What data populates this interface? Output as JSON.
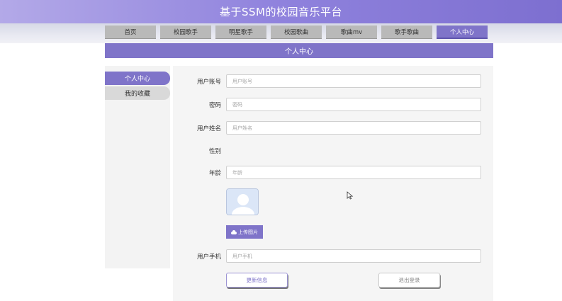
{
  "header": {
    "title": "基于SSM的校园音乐平台"
  },
  "nav": {
    "items": [
      {
        "label": "首页",
        "active": false
      },
      {
        "label": "校园歌手",
        "active": false
      },
      {
        "label": "明星歌手",
        "active": false
      },
      {
        "label": "校园歌曲",
        "active": false
      },
      {
        "label": "歌曲mv",
        "active": false
      },
      {
        "label": "歌手歌曲",
        "active": false
      },
      {
        "label": "个人中心",
        "active": true
      }
    ]
  },
  "page_title": "个人中心",
  "sidebar": {
    "items": [
      {
        "label": "个人中心",
        "active": true
      },
      {
        "label": "我的收藏",
        "active": false
      }
    ]
  },
  "form": {
    "account": {
      "label": "用户账号",
      "placeholder": "用户账号",
      "value": ""
    },
    "password": {
      "label": "密码",
      "placeholder": "密码",
      "value": ""
    },
    "name": {
      "label": "用户姓名",
      "placeholder": "用户姓名",
      "value": ""
    },
    "gender": {
      "label": "性别"
    },
    "age": {
      "label": "年龄",
      "placeholder": "年龄",
      "value": ""
    },
    "upload_label": "上传图片",
    "phone": {
      "label": "用户手机",
      "placeholder": "用户手机",
      "value": ""
    },
    "update_label": "更新信息",
    "logout_label": "退出登录"
  },
  "colors": {
    "accent": "#7f74c9",
    "nav_inactive": "#b9b9b9",
    "panel_bg": "#f5f5f5"
  },
  "icons": {
    "avatar": "user-avatar-placeholder",
    "upload": "cloud-upload-icon",
    "cursor": "mouse-pointer"
  }
}
